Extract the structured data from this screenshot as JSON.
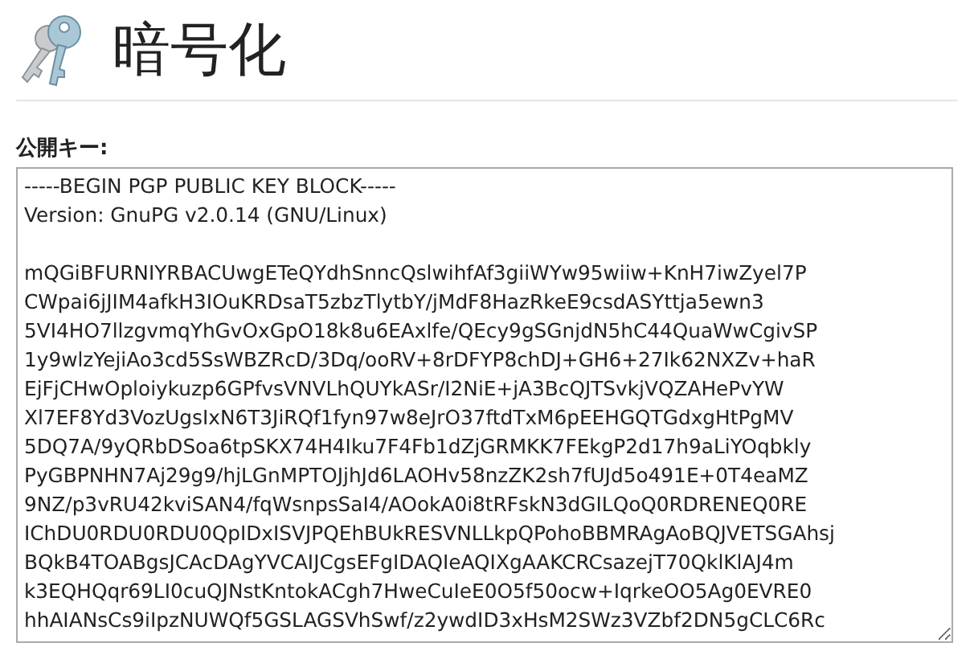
{
  "header": {
    "title": "暗号化"
  },
  "public_key": {
    "label": "公開キー:",
    "value": "-----BEGIN PGP PUBLIC KEY BLOCK-----\nVersion: GnuPG v2.0.14 (GNU/Linux)\n\nmQGiBFURNIYRBACUwgETeQYdhSnncQslwihfAf3giiWYw95wiiw+KnH7iwZyel7P\nCWpai6jJIM4afkH3IOuKRDsaT5zbzTlytbY/jMdF8HazRkeE9csdASYttja5ewn3\n5VI4HO7llzgvmqYhGvOxGpO18k8u6EAxlfe/QEcy9gSGnjdN5hC44QuaWwCgivSP\n1y9wlzYejiAo3cd5SsWBZRcD/3Dq/ooRV+8rDFYP8chDJ+GH6+27Ik62NXZv+haR\nEjFjCHwOploiykuzp6GPfvsVNVLhQUYkASr/I2NiE+jA3BcQJTSvkjVQZAHePvYW\nXl7EF8Yd3VozUgsIxN6T3JiRQf1fyn97w8eJrO37ftdTxM6pEEHGQTGdxgHtPgMV\n5DQ7A/9yQRbDSoa6tpSKX74H4Iku7F4Fb1dZjGRMKK7FEkgP2d17h9aLiYOqbkly\nPyGBPNHN7Aj29g9/hjLGnMPTOJjhJd6LAOHv58nzZK2sh7fUJd5o491E+0T4eaMZ\n9NZ/p3vRU42kviSAN4/fqWsnpsSaI4/AOokA0i8tRFskN3dGILQoQ0RDRENEQ0RE\nIChDU0RDU0RDU0QpIDxISVJPQEhBUkRESVNLLkpQPohoBBMRAgAoBQJVETSGAhsj\nBQkB4TOABgsJCAcDAgYVCAIJCgsEFgIDAQIeAQIXgAAKCRCsazejT70QklKlAJ4m\nk3EQHQqr69LI0cuQJNstKntokACgh7HweCuIeE0O5f50ocw+IqrkeOO5Ag0EVRE0\nhhAIANsCs9iIpzNUWQf5GSLAGSVhSwf/z2ywdID3xHsM2SWz3VZbf2DN5gCLC6Rc"
  }
}
